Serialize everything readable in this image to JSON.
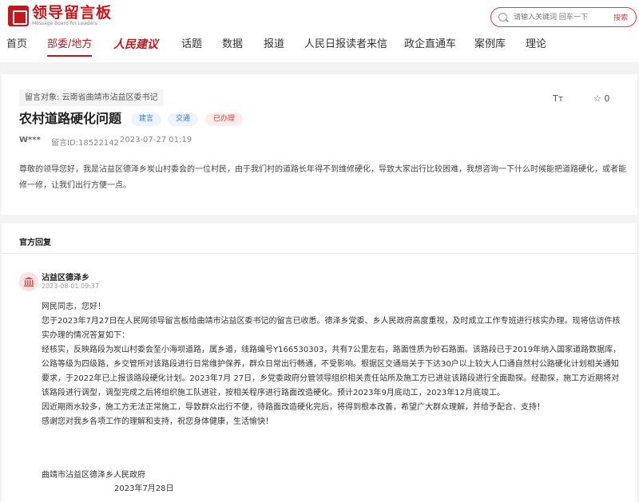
{
  "header": {
    "logo_title": "领导留言板",
    "logo_subtitle": "Message Board for Leaders",
    "search_placeholder": "请输入关键词 回车一下",
    "search_button": "搜索"
  },
  "nav": {
    "items": [
      "首页",
      "部委/地方",
      "人民建议",
      "话题",
      "数据",
      "报道",
      "人民日报读者来信",
      "政企直通车",
      "案例库",
      "理论"
    ]
  },
  "message": {
    "target_label": "留言对象:",
    "target": "云南省曲靖市沾益区委书记",
    "title": "农村道路硬化问题",
    "tags": [
      "建言",
      "交通",
      "已办理"
    ],
    "font_button": "Tт",
    "favorite_count": "☆ 0",
    "user": "W***",
    "id_label": "留言ID:18522142",
    "time": "2023-07-27 01:19",
    "content": "尊敬的领导您好，我是沾益区德泽乡炭山村委会的一位村民，由于我们村的道路长年得不到维修硬化，导致大家出行比较困难，我想咨询一下什么时候能把道路硬化，或者能修一修，让我们出行方便一点。"
  },
  "reply": {
    "section_title": "官方回复",
    "replier": "沾益区德泽乡",
    "time": "2023-08-01 09:37",
    "paragraphs": [
      "网民同志，您好！",
      "您于2023年7月27日在人民网领导留言板给曲靖市沾益区委书记的留言已收悉。德泽乡党委、乡人民政府高度重视，及时成立工作专班进行核实办理。现将信访件核实办理的情况答复如下：",
      "经核实，反映路段为炭山村委会至小海坝道路，属乡道，线路编号Y166530303，共有7公里左右，路面性质为砂石路面。该路段已于2019年纳入国家道路数据库，公路等级为四级路，乡交管所对该路段进行日常维护保养，群众日常出行畅通，不受影响。根据区交通局关于下达30户以上较大人口通自然村公路硬化计划相关通知要求，于2022年已上报该路段硬化计划。2023年7月 27日，乡党委政府分管领导组织相关责任站所及施工方已进驻该路段进行全面勘探。经勘探，施工方近期将对该路段进行调型，调型完成之后将组织施工队进驻，按相关程序进行路面改造硬化。预计2023年9月底动工，2023年12月底竣工。",
      "因近期雨水较多，施工方无法正常施工，导致群众出行不便，待路面改造硬化完后，将得到根本改善，希望广大群众理解，并给予配合、支持！",
      "感谢您对我乡各项工作的理解和支持，祝您身体健康，生活愉快！"
    ],
    "signature_org": "曲靖市沾益区德泽乡人民政府",
    "signature_date": "2023年7月28日"
  }
}
